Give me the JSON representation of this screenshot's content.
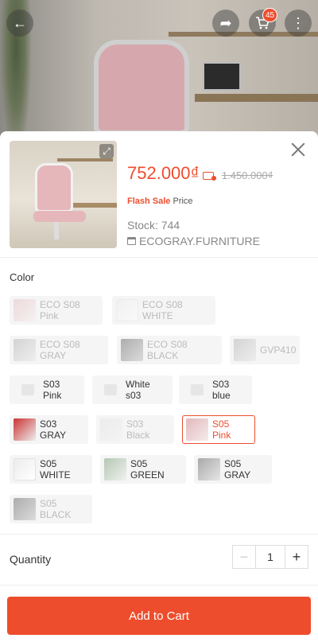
{
  "header": {
    "cart_count": "45",
    "icons": [
      "back-arrow-icon",
      "share-icon",
      "cart-icon",
      "more-vertical-icon"
    ]
  },
  "product": {
    "price": "752.000₫",
    "old_price": "1.450.000₫",
    "flash_label": "Flash Sale",
    "price_label": "Price",
    "stock": "Stock: 744",
    "shop": "ECOGRAY.FURNITURE"
  },
  "variations": {
    "label": "Color",
    "options": [
      {
        "label": "ECO S08 Pink",
        "state": "disabled"
      },
      {
        "label": "ECO S08 WHITE",
        "state": "disabled"
      },
      {
        "label": "ECO S08 GRAY",
        "state": "disabled"
      },
      {
        "label": "ECO S08 BLACK",
        "state": "disabled"
      },
      {
        "label": "GVP410",
        "state": "disabled"
      },
      {
        "label": "S03 Pink",
        "state": "available"
      },
      {
        "label": "White s03",
        "state": "available"
      },
      {
        "label": "S03 blue",
        "state": "available"
      },
      {
        "label": "S03 GRAY",
        "state": "available"
      },
      {
        "label": "S03 Black",
        "state": "disabled"
      },
      {
        "label": "S05 Pink",
        "state": "selected"
      },
      {
        "label": "S05 WHITE",
        "state": "available"
      },
      {
        "label": "S05 GREEN",
        "state": "available"
      },
      {
        "label": "S05 GRAY",
        "state": "available"
      },
      {
        "label": "S05 BLACK",
        "state": "disabled"
      }
    ]
  },
  "quantity": {
    "label": "Quantity",
    "value": "1",
    "minus": "−",
    "plus": "+"
  },
  "actions": {
    "add_to_cart": "Add to Cart"
  },
  "colors": {
    "accent": "#ee4d2d"
  }
}
